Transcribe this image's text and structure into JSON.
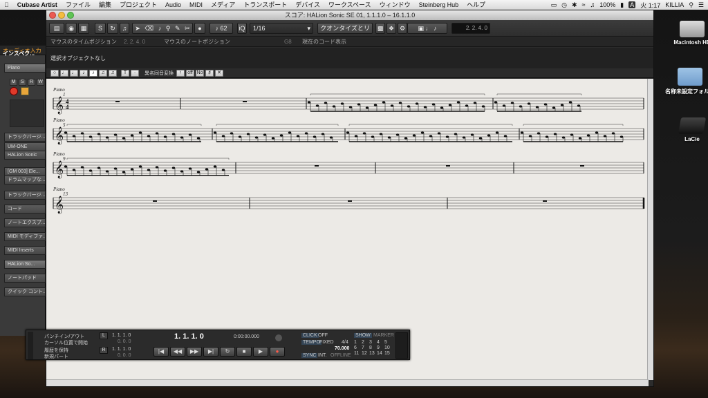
{
  "menubar": {
    "app_name": "Cubase Artist",
    "items": [
      "ファイル",
      "編集",
      "プロジェクト",
      "Audio",
      "MIDI",
      "メディア",
      "トランスポート",
      "デバイス",
      "ワークスペース",
      "ウィンドウ",
      "Steinberg Hub",
      "ヘルプ"
    ],
    "battery": "100%",
    "input_indicator": "A",
    "clock": "火 1:17",
    "user": "KILLIA"
  },
  "window": {
    "title": "スコア: HALion Sonic SE 01, 1.1.1.0 – 16.1.1.0"
  },
  "toolbar": {
    "quantize_value": "62",
    "grid_value": "1/16",
    "quantize_label": "クオンタイズとリ",
    "position_display": "2. 2. 4. 0"
  },
  "infoline": {
    "mouse_time_label": "マウスのタイムポジション",
    "mouse_time_value": "2. 2. 4. 0",
    "mouse_note_label": "マウスのノートポジション",
    "mouse_note_value": "G8",
    "current_chord_label": "現在のコード表示"
  },
  "status": {
    "selection_text": "選択オブジェクトなし"
  },
  "symbolbar": {
    "enharmonic_label": "異名同音変換",
    "enharmonic_buttons": [
      "♮",
      "off",
      "No",
      "♯",
      "✕"
    ]
  },
  "inspector": {
    "tabs": [
      "オーディオ入力",
      "インスペク..."
    ],
    "track_name": "Piano",
    "track_buttons": [
      "M",
      "S",
      "R",
      "W"
    ],
    "track_version": "トラックバージ...",
    "instrument1": "UM-ONE",
    "instrument2": "HALion Sonic",
    "patch": "[GM 003] Ele...",
    "drum_map": "ドラムマップな...",
    "sections": [
      "トラックバージ...",
      "コード",
      "ノートエクスプ...",
      "MIDI モディファ...",
      "MIDI Inserts",
      "HALion So...",
      "ノートパッド",
      "クイック コント..."
    ]
  },
  "transport": {
    "punch_label": "パンチイン/アウト",
    "cursor_label": "カーソル位置で開始",
    "keep_label": "履歴を保持",
    "new_part_label": "新規パート",
    "left_locator": "1. 1. 1. 0",
    "left_locator2": "0. 0. 0",
    "right_locator": "1. 1. 1. 0",
    "right_locator2": "0. 0. 0",
    "primary_time": "1. 1. 1.   0",
    "secondary_time": "0:00:00.000",
    "click_label": "CLICK",
    "click_value": "OFF",
    "tempo_label": "TEMPO",
    "tempo_mode": "FIXED",
    "signature": "4/4",
    "tempo_value": "70.000",
    "sync_label": "SYNC",
    "sync_mode": "INT.",
    "sync_state": "OFFLINE",
    "show_label": "SHOW",
    "marker_label": "MARKER",
    "markers": [
      "1",
      "2",
      "3",
      "4",
      "5",
      "6",
      "7",
      "8",
      "9",
      "10",
      "11",
      "12",
      "13",
      "14",
      "15"
    ]
  },
  "score": {
    "staff_label": "Piano",
    "systems": [
      {
        "measure_number": "1"
      },
      {
        "measure_number": "5"
      },
      {
        "measure_number": "9"
      },
      {
        "measure_number": "13"
      }
    ]
  },
  "desktop": {
    "icons": [
      "Macintosh HD",
      "名称未設定フォルダ",
      "LaCie"
    ]
  },
  "colors": {
    "accent_orange": "#e8a53a",
    "record_red": "#e03a2a",
    "paper": "#eceae6"
  }
}
